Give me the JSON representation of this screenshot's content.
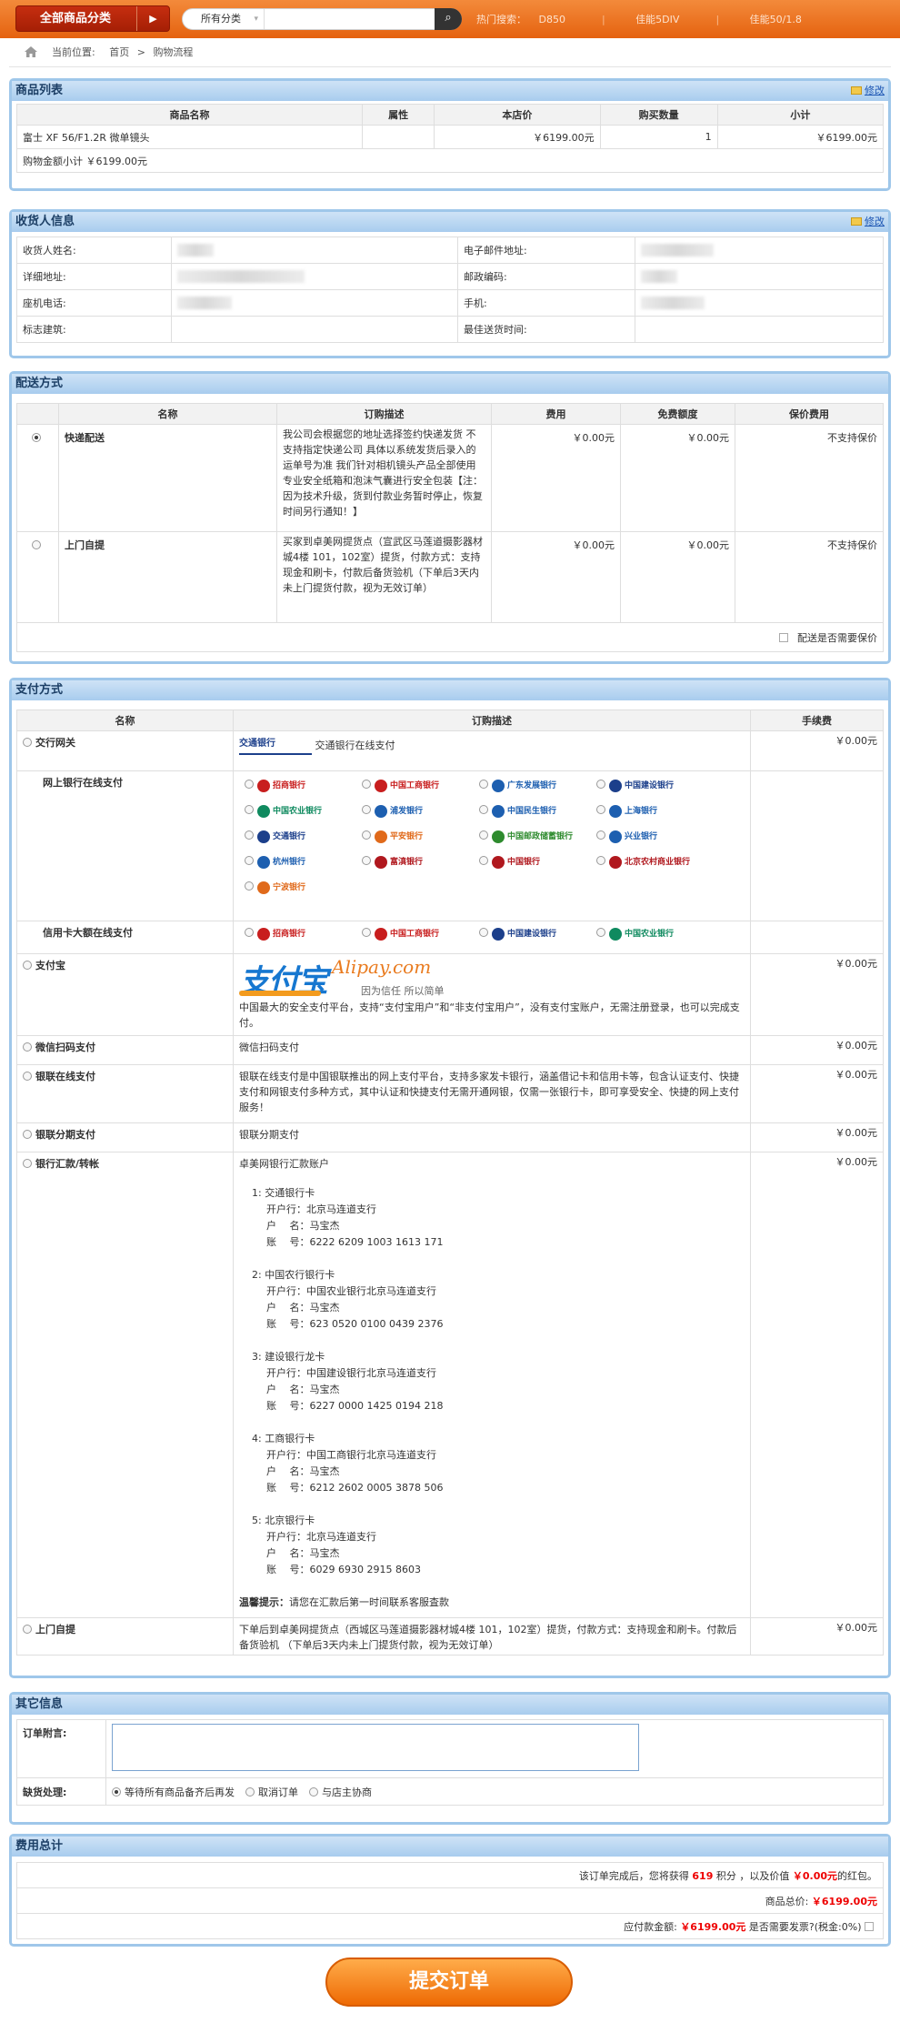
{
  "topbar": {
    "category_button": "全部商品分类",
    "search_select": "所有分类",
    "search_placeholder": "",
    "hot_label": "热门搜索：",
    "hot_items": [
      "D850",
      "佳能5DIV",
      "佳能50/1.8"
    ]
  },
  "breadcrumb": {
    "label": "当前位置:",
    "home": "首页",
    "sep": ">",
    "current": "购物流程"
  },
  "goods": {
    "title": "商品列表",
    "edit": "修改",
    "headers": [
      "商品名称",
      "属性",
      "本店价",
      "购买数量",
      "小计"
    ],
    "rows": [
      {
        "name": "富士 XF 56/F1.2R 微单镜头",
        "attr": "",
        "price": "￥6199.00元",
        "qty": "1",
        "subtotal": "￥6199.00元"
      }
    ],
    "total": "购物金额小计 ￥6199.00元"
  },
  "consignee": {
    "title": "收货人信息",
    "edit": "修改",
    "name_label": "收货人姓名:",
    "email_label": "电子邮件地址:",
    "address_label": "详细地址:",
    "zip_label": "邮政编码:",
    "tel_label": "座机电话:",
    "mobile_label": "手机:",
    "building_label": "标志建筑:",
    "best_time_label": "最佳送货时间:"
  },
  "shipping": {
    "title": "配送方式",
    "headers": [
      "名称",
      "订购描述",
      "费用",
      "免费额度",
      "保价费用"
    ],
    "rows": [
      {
        "name": "快递配送",
        "selected": true,
        "desc": "我公司会根据您的地址选择签约快递发货 不支持指定快递公司 具体以系统发货后录入的运单号为准 我们针对相机镜头产品全部使用专业安全纸箱和泡沫气囊进行安全包装【注：因为技术升级，货到付款业务暂时停止，恢复时间另行通知！】",
        "fee": "￥0.00元",
        "free": "￥0.00元",
        "insure": "不支持保价"
      },
      {
        "name": "上门自提",
        "selected": false,
        "desc": "买家到卓美网提货点（宣武区马莲道摄影器材城4楼 101，102室）提货，付款方式：支持现金和刷卡，付款后备货验机（下单后3天内未上门提货付款，视为无效订单）",
        "fee": "￥0.00元",
        "free": "￥0.00元",
        "insure": "不支持保价"
      }
    ],
    "insure_note": "配送是否需要保价"
  },
  "payment": {
    "title": "支付方式",
    "headers": [
      "名称",
      "订购描述",
      "手续费"
    ],
    "bocom": {
      "name": "交行网关",
      "bank": "交通银行",
      "desc": "交通银行在线支付",
      "fee": "￥0.00元"
    },
    "ebank": {
      "name": "网上银行在线支付",
      "banks": [
        "招商银行",
        "中国工商银行",
        "广东发展银行",
        "中国建设银行",
        "中国农业银行",
        "浦发银行",
        "中国民生银行",
        "上海银行",
        "交通银行",
        "平安银行",
        "中国邮政储蓄银行",
        "兴业银行",
        "杭州银行",
        "富滇银行",
        "中国银行",
        "北京农村商业银行",
        "宁波银行"
      ]
    },
    "credit": {
      "name": "信用卡大额在线支付",
      "banks": [
        "招商银行",
        "中国工商银行",
        "中国建设银行",
        "中国农业银行"
      ]
    },
    "alipay": {
      "name": "支付宝",
      "logo_cn": "支付宝",
      "logo_en": "Alipay.com",
      "slogan": "因为信任  所以简单",
      "desc": "中国最大的安全支付平台，支持“支付宝用户”和“非支付宝用户”，没有支付宝账户，无需注册登录，也可以完成支付。",
      "fee": "￥0.00元"
    },
    "wechat": {
      "name": "微信扫码支付",
      "desc": "微信扫码支付",
      "fee": "￥0.00元"
    },
    "unionpay": {
      "name": "银联在线支付",
      "desc": "银联在线支付是中国银联推出的网上支付平台，支持多家发卡银行，涵盖借记卡和信用卡等，包含认证支付、快捷支付和网银支付多种方式，其中认证和快捷支付无需开通网银，仅需一张银行卡，即可享受安全、快捷的网上支付服务！",
      "fee": "￥0.00元"
    },
    "installment": {
      "name": "银联分期支付",
      "desc": "银联分期支付",
      "fee": "￥0.00元"
    },
    "transfer": {
      "name": "银行汇款/转帐",
      "fee": "￥0.00元",
      "title": "卓美网银行汇款账户",
      "accounts": [
        {
          "no": "1:",
          "bank": "交通银行卡",
          "branch_label": "开户行：",
          "branch": "北京马连道支行",
          "holder_label": "户　 名：",
          "holder": "马宝杰",
          "acct_label": "账　 号：",
          "acct": "6222 6209 1003 1613 171"
        },
        {
          "no": "2:",
          "bank": "中国农行银行卡",
          "branch_label": "开户行：",
          "branch": "中国农业银行北京马连道支行",
          "holder_label": "户　 名：",
          "holder": "马宝杰",
          "acct_label": "账　 号：",
          "acct": "623 0520 0100 0439 2376"
        },
        {
          "no": "3:",
          "bank": "建设银行龙卡",
          "branch_label": "开户行：",
          "branch": "中国建设银行北京马连道支行",
          "holder_label": "户　 名：",
          "holder": "马宝杰",
          "acct_label": "账　 号：",
          "acct": "6227 0000 1425 0194 218"
        },
        {
          "no": "4:",
          "bank": "工商银行卡",
          "branch_label": "开户行：",
          "branch": "中国工商银行北京马连道支行",
          "holder_label": "户　 名：",
          "holder": "马宝杰",
          "acct_label": "账　 号：",
          "acct": "6212 2602 0005 3878 506"
        },
        {
          "no": "5:",
          "bank": "北京银行卡",
          "branch_label": "开户行：",
          "branch": "北京马连道支行",
          "holder_label": "户　 名：",
          "holder": "马宝杰",
          "acct_label": "账　 号：",
          "acct": "6029 6930 2915 8603"
        }
      ],
      "tip_label": "温馨提示：",
      "tip": "请您在汇款后第一时间联系客服査款"
    },
    "pickup": {
      "name": "上门自提",
      "desc": "下单后到卓美网提货点（西城区马莲道摄影器材城4楼 101，102室）提货，付款方式：支持现金和刷卡。付款后备货验机 （下单后3天内未上门提货付款，视为无效订单）",
      "fee": "￥0.00元"
    }
  },
  "other": {
    "title": "其它信息",
    "message_label": "订单附言:",
    "shortage_label": "缺货处理:",
    "options": [
      "等待所有商品备齐后再发",
      "取消订单",
      "与店主协商"
    ]
  },
  "summary": {
    "title": "费用总计",
    "points_pre": "该订单完成后，您将获得",
    "points": "619",
    "points_mid": "积分 ，以及价值",
    "bonus": "￥0.00元",
    "bonus_post": "的红包。",
    "goods_total_label": "商品总价:",
    "goods_total": "￥6199.00元",
    "pay_label": "应付款金额:",
    "pay": "￥6199.00元",
    "invoice": "是否需要发票?(税金:0%)"
  },
  "submit": "提交订单",
  "colors": {
    "orange": "#ee6a04",
    "panel_border": "#9fc7ea",
    "price_red": "#e00000"
  }
}
